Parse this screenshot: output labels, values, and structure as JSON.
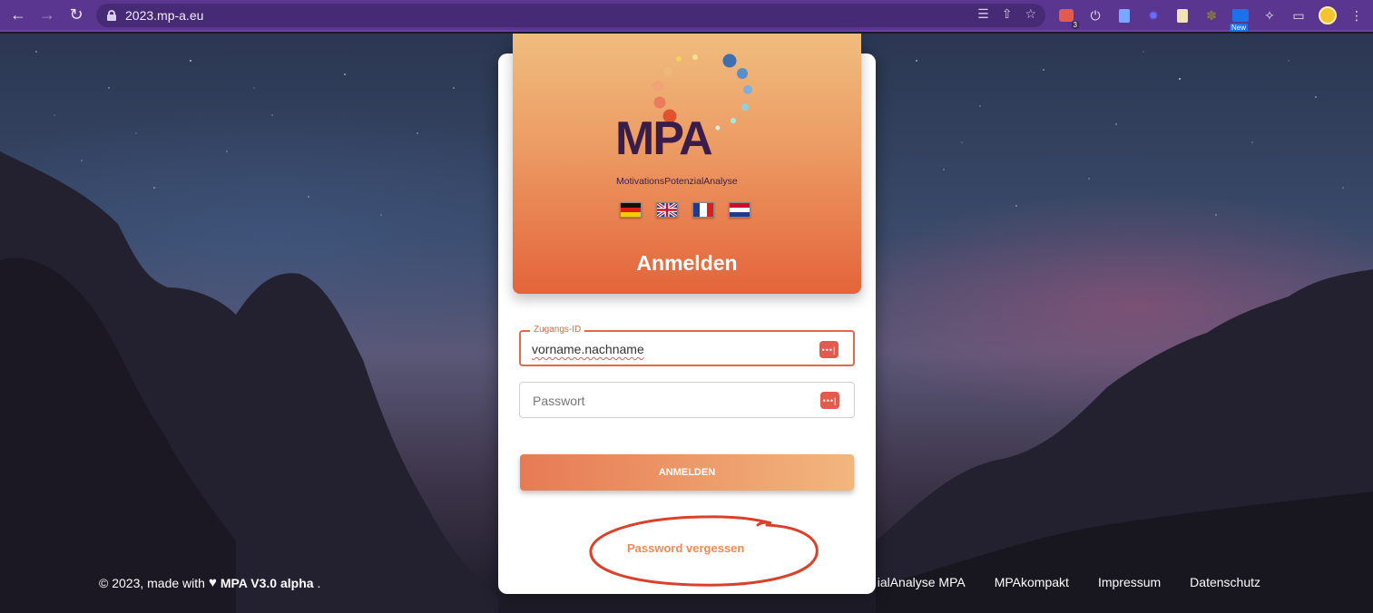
{
  "browser": {
    "url": "2023.mp-a.eu",
    "extension_badge": "3",
    "extension_new_tag": "New"
  },
  "header": {
    "brand": "MPA",
    "brand_subtitle": "MotivationsPotenzialAnalyse",
    "title": "Anmelden",
    "flags": [
      "german-flag",
      "uk-flag",
      "french-flag",
      "dutch-flag"
    ]
  },
  "form": {
    "id_label": "Zugangs-ID",
    "id_value": "vorname.nachname",
    "password_placeholder": "Passwort",
    "submit_label": "ANMELDEN",
    "forgot_label": "Password vergessen"
  },
  "footer": {
    "copyright": "© 2023, made with",
    "version": "MPA V3.0 alpha",
    "period": ".",
    "links": [
      "ialAnalyse MPA",
      "MPAkompakt",
      "Impressum",
      "Datenschutz"
    ]
  },
  "colors": {
    "chrome": "#5a3690",
    "accent": "#e06a45",
    "header_top": "#f0bd7e",
    "header_bottom": "#e4643a",
    "annotation": "#d9412a"
  }
}
